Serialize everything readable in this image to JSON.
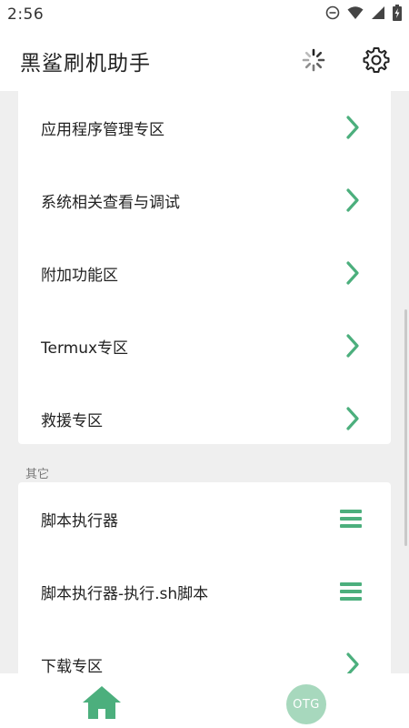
{
  "status_bar": {
    "time": "2:56",
    "icons": [
      "do-not-disturb-icon",
      "wifi-icon",
      "signal-icon",
      "battery-charging-icon"
    ]
  },
  "app_bar": {
    "title": "黑鲨刷机助手",
    "actions": [
      "loading-spinner-icon",
      "settings-gear-icon"
    ]
  },
  "colors": {
    "accent": "#4caf7d",
    "otg_badge": "#a7d8bd",
    "background": "#efefef"
  },
  "card1": {
    "items": [
      {
        "label": "应用程序管理专区",
        "icon": "chevron-right-icon"
      },
      {
        "label": "系统相关查看与调试",
        "icon": "chevron-right-icon"
      },
      {
        "label": "附加功能区",
        "icon": "chevron-right-icon"
      },
      {
        "label": "Termux专区",
        "icon": "chevron-right-icon"
      },
      {
        "label": "救援专区",
        "icon": "chevron-right-icon"
      }
    ]
  },
  "section_other": {
    "title": "其它",
    "items": [
      {
        "label": "脚本执行器",
        "icon": "menu-icon"
      },
      {
        "label": "脚本执行器-执行.sh脚本",
        "icon": "menu-icon"
      },
      {
        "label": "下载专区",
        "icon": "chevron-right-icon"
      }
    ]
  },
  "bottom_nav": {
    "home_icon": "home-icon",
    "otg_label": "OTG"
  }
}
